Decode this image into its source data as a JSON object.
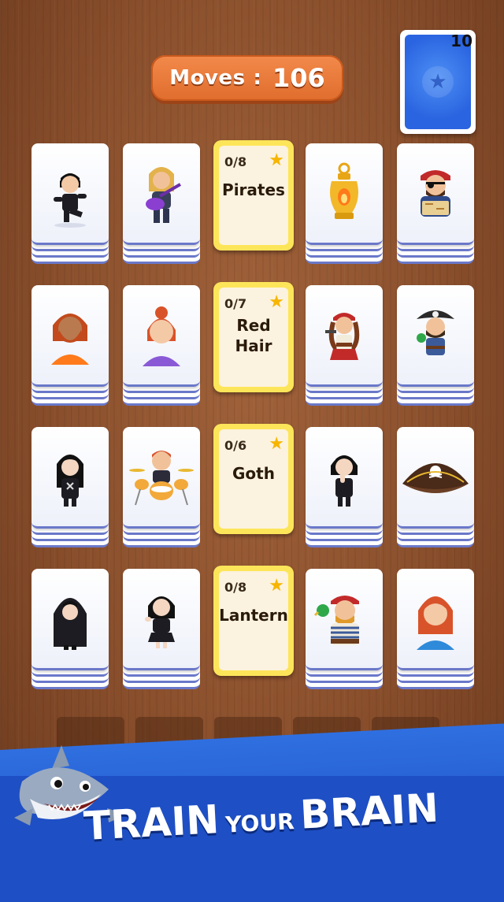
{
  "hud": {
    "moves_label": "Moves",
    "moves_sep": ":",
    "moves_value": "106",
    "deck_count": "10"
  },
  "rows": [
    {
      "category": {
        "count": "0/8",
        "name": "Pirates"
      },
      "cards": [
        "goth-kicker-icon",
        "guitarist-icon",
        "gold-lantern-icon",
        "pirate-map-icon"
      ]
    },
    {
      "category": {
        "count": "0/7",
        "name": "Red Hair"
      },
      "cards": [
        "bearded-redhead-icon",
        "redhead-girl-icon",
        "pirate-girl-icon",
        "pirate-captain-icon"
      ]
    },
    {
      "category": {
        "count": "0/6",
        "name": "Goth"
      },
      "cards": [
        "goth-girl-icon",
        "drummer-icon",
        "goth-thinker-icon",
        "pirate-hat-icon"
      ]
    },
    {
      "category": {
        "count": "0/8",
        "name": "Lantern"
      },
      "cards": [
        "hooded-goth-icon",
        "goth-peace-girl-icon",
        "pirate-parrot-icon",
        "redhead-woman-icon"
      ]
    }
  ],
  "banner": {
    "word1": "TRAIN",
    "word2": "YOUR",
    "word3": "BRAIN"
  },
  "colors": {
    "accent_orange": "#e06d2d",
    "deck_blue": "#2a64e0",
    "category_gold": "#fde55a",
    "banner_blue": "#1e4fc4"
  }
}
